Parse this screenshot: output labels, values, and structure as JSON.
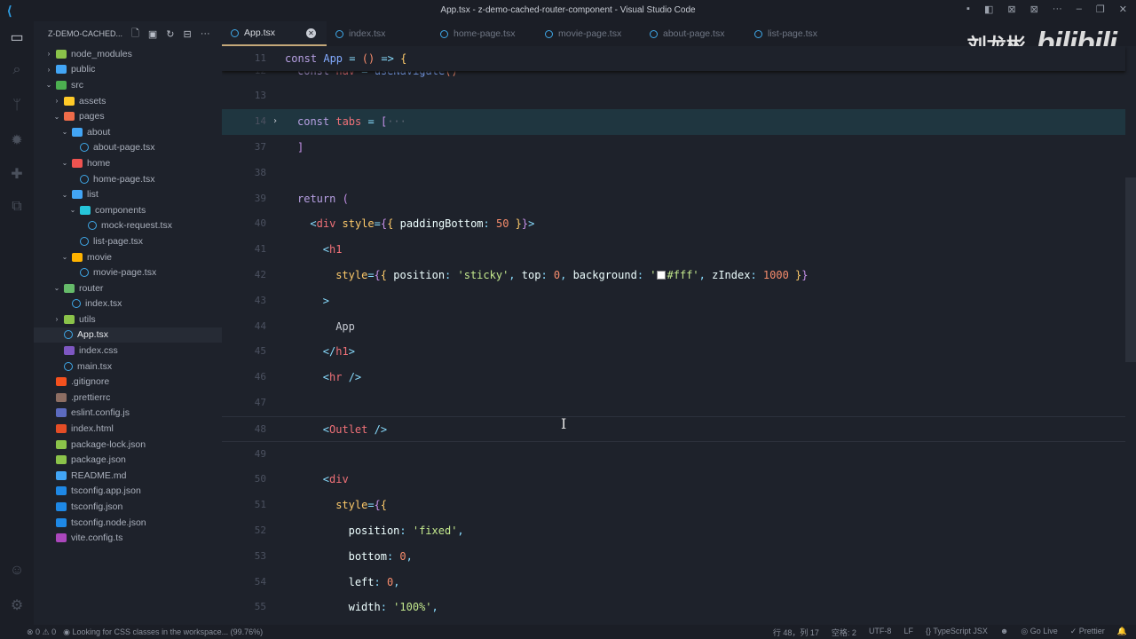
{
  "window": {
    "title": "App.tsx - z-demo-cached-router-component - Visual Studio Code"
  },
  "explorer": {
    "title": "Z-DEMO-CACHED...",
    "items": [
      {
        "label": "node_modules",
        "depth": 0,
        "kind": "folder",
        "open": false,
        "color": "#8bc34a"
      },
      {
        "label": "public",
        "depth": 0,
        "kind": "folder",
        "open": false,
        "color": "#42a5f5"
      },
      {
        "label": "src",
        "depth": 0,
        "kind": "folder",
        "open": true,
        "color": "#4caf50"
      },
      {
        "label": "assets",
        "depth": 1,
        "kind": "folder",
        "open": false,
        "color": "#ffca28"
      },
      {
        "label": "pages",
        "depth": 1,
        "kind": "folder",
        "open": true,
        "color": "#ef6c4a"
      },
      {
        "label": "about",
        "depth": 2,
        "kind": "folder",
        "open": true,
        "color": "#42a5f5"
      },
      {
        "label": "about-page.tsx",
        "depth": 3,
        "kind": "react"
      },
      {
        "label": "home",
        "depth": 2,
        "kind": "folder",
        "open": true,
        "color": "#ef5350"
      },
      {
        "label": "home-page.tsx",
        "depth": 3,
        "kind": "react"
      },
      {
        "label": "list",
        "depth": 2,
        "kind": "folder",
        "open": true,
        "color": "#42a5f5"
      },
      {
        "label": "components",
        "depth": 3,
        "kind": "folder",
        "open": true,
        "color": "#26c6da"
      },
      {
        "label": "mock-request.tsx",
        "depth": 4,
        "kind": "react"
      },
      {
        "label": "list-page.tsx",
        "depth": 3,
        "kind": "react"
      },
      {
        "label": "movie",
        "depth": 2,
        "kind": "folder",
        "open": true,
        "color": "#ffb300"
      },
      {
        "label": "movie-page.tsx",
        "depth": 3,
        "kind": "react"
      },
      {
        "label": "router",
        "depth": 1,
        "kind": "folder",
        "open": true,
        "color": "#66bb6a"
      },
      {
        "label": "index.tsx",
        "depth": 2,
        "kind": "react"
      },
      {
        "label": "utils",
        "depth": 1,
        "kind": "folder",
        "open": false,
        "color": "#8bc34a"
      },
      {
        "label": "App.tsx",
        "depth": 1,
        "kind": "react",
        "selected": true
      },
      {
        "label": "index.css",
        "depth": 1,
        "kind": "file",
        "color": "#7e57c2"
      },
      {
        "label": "main.tsx",
        "depth": 1,
        "kind": "react"
      },
      {
        "label": ".gitignore",
        "depth": 0,
        "kind": "file",
        "color": "#f4511e"
      },
      {
        "label": ".prettierrc",
        "depth": 0,
        "kind": "file",
        "color": "#8d6e63"
      },
      {
        "label": "eslint.config.js",
        "depth": 0,
        "kind": "file",
        "color": "#5c6bc0"
      },
      {
        "label": "index.html",
        "depth": 0,
        "kind": "file",
        "color": "#e44d26"
      },
      {
        "label": "package-lock.json",
        "depth": 0,
        "kind": "file",
        "color": "#8bc34a"
      },
      {
        "label": "package.json",
        "depth": 0,
        "kind": "file",
        "color": "#8bc34a"
      },
      {
        "label": "README.md",
        "depth": 0,
        "kind": "file",
        "color": "#42a5f5"
      },
      {
        "label": "tsconfig.app.json",
        "depth": 0,
        "kind": "file",
        "color": "#1e88e5"
      },
      {
        "label": "tsconfig.json",
        "depth": 0,
        "kind": "file",
        "color": "#1e88e5"
      },
      {
        "label": "tsconfig.node.json",
        "depth": 0,
        "kind": "file",
        "color": "#1e88e5"
      },
      {
        "label": "vite.config.ts",
        "depth": 0,
        "kind": "file",
        "color": "#ab47bc"
      }
    ]
  },
  "tabs": [
    {
      "label": "App.tsx",
      "active": true
    },
    {
      "label": "index.tsx"
    },
    {
      "label": "home-page.tsx"
    },
    {
      "label": "movie-page.tsx"
    },
    {
      "label": "about-page.tsx"
    },
    {
      "label": "list-page.tsx"
    }
  ],
  "watermark": {
    "name": "刘龙彬",
    "logo": "bilibili"
  },
  "editor": {
    "sticky": {
      "n": "11",
      "indent": 0,
      "tokens": [
        [
          "const ",
          "kw"
        ],
        [
          "App",
          "fn"
        ],
        [
          " = ",
          "op"
        ],
        [
          "()",
          "b2"
        ],
        [
          " => ",
          "op"
        ],
        [
          "{",
          "b1"
        ]
      ]
    },
    "lines": [
      {
        "n": "12",
        "indent": 1,
        "tokens": [
          [
            "const ",
            "kw"
          ],
          [
            "nav",
            "var"
          ],
          [
            " = ",
            "op"
          ],
          [
            "useNavigate",
            "fn"
          ],
          [
            "()",
            "b2"
          ]
        ]
      },
      {
        "n": "13",
        "indent": 0,
        "tokens": []
      },
      {
        "n": "14",
        "indent": 1,
        "fold": true,
        "hl": true,
        "tokens": [
          [
            "const ",
            "kw"
          ],
          [
            "tabs",
            "var"
          ],
          [
            " = ",
            "op"
          ],
          [
            "[",
            "b3"
          ],
          [
            "···",
            "dim"
          ]
        ]
      },
      {
        "n": "37",
        "indent": 1,
        "tokens": [
          [
            "]",
            "b3"
          ]
        ]
      },
      {
        "n": "38",
        "indent": 0,
        "tokens": []
      },
      {
        "n": "39",
        "indent": 1,
        "tokens": [
          [
            "return ",
            "kw"
          ],
          [
            "(",
            "b3"
          ]
        ]
      },
      {
        "n": "40",
        "indent": 2,
        "tokens": [
          [
            "<",
            "pn"
          ],
          [
            "div",
            "tag"
          ],
          [
            " style",
            "attr"
          ],
          [
            "=",
            "op"
          ],
          [
            "{",
            "b3"
          ],
          [
            "{",
            "b1"
          ],
          [
            " paddingBottom",
            "prop"
          ],
          [
            ": ",
            "op"
          ],
          [
            "50",
            "num"
          ],
          [
            " }",
            "b1"
          ],
          [
            "}",
            "b3"
          ],
          [
            ">",
            "pn"
          ]
        ]
      },
      {
        "n": "41",
        "indent": 3,
        "tokens": [
          [
            "<",
            "pn"
          ],
          [
            "h1",
            "tag"
          ]
        ]
      },
      {
        "n": "42",
        "indent": 4,
        "tokens": [
          [
            "style",
            "attr"
          ],
          [
            "=",
            "op"
          ],
          [
            "{",
            "b3"
          ],
          [
            "{",
            "b1"
          ],
          [
            " position",
            "prop"
          ],
          [
            ": ",
            "op"
          ],
          [
            "'sticky'",
            "str"
          ],
          [
            ", ",
            "op"
          ],
          [
            "top",
            "prop"
          ],
          [
            ": ",
            "op"
          ],
          [
            "0",
            "num"
          ],
          [
            ", ",
            "op"
          ],
          [
            "background",
            "prop"
          ],
          [
            ": ",
            "op"
          ],
          [
            "'",
            "str"
          ],
          [
            "#fff",
            "str",
            "swatch"
          ],
          [
            "'",
            "str"
          ],
          [
            ", ",
            "op"
          ],
          [
            "zIndex",
            "prop"
          ],
          [
            ": ",
            "op"
          ],
          [
            "1000",
            "num"
          ],
          [
            " }",
            "b1"
          ],
          [
            "}",
            "b3"
          ]
        ]
      },
      {
        "n": "43",
        "indent": 3,
        "tokens": [
          [
            ">",
            "pn"
          ]
        ]
      },
      {
        "n": "44",
        "indent": 4,
        "tokens": [
          [
            "App",
            "txt"
          ]
        ]
      },
      {
        "n": "45",
        "indent": 3,
        "tokens": [
          [
            "</",
            "pn"
          ],
          [
            "h1",
            "tag"
          ],
          [
            ">",
            "pn"
          ]
        ]
      },
      {
        "n": "46",
        "indent": 3,
        "tokens": [
          [
            "<",
            "pn"
          ],
          [
            "hr",
            "tag"
          ],
          [
            " />",
            "pn"
          ]
        ]
      },
      {
        "n": "47",
        "indent": 0,
        "tokens": []
      },
      {
        "n": "48",
        "indent": 3,
        "cur": true,
        "tokens": [
          [
            "<",
            "pn"
          ],
          [
            "Outlet",
            "tag"
          ],
          [
            " />",
            "pn"
          ]
        ]
      },
      {
        "n": "49",
        "indent": 0,
        "tokens": []
      },
      {
        "n": "50",
        "indent": 3,
        "tokens": [
          [
            "<",
            "pn"
          ],
          [
            "div",
            "tag"
          ]
        ]
      },
      {
        "n": "51",
        "indent": 4,
        "tokens": [
          [
            "style",
            "attr"
          ],
          [
            "=",
            "op"
          ],
          [
            "{",
            "b3"
          ],
          [
            "{",
            "b1"
          ]
        ]
      },
      {
        "n": "52",
        "indent": 5,
        "tokens": [
          [
            "position",
            "prop"
          ],
          [
            ": ",
            "op"
          ],
          [
            "'fixed'",
            "str"
          ],
          [
            ",",
            "op"
          ]
        ]
      },
      {
        "n": "53",
        "indent": 5,
        "tokens": [
          [
            "bottom",
            "prop"
          ],
          [
            ": ",
            "op"
          ],
          [
            "0",
            "num"
          ],
          [
            ",",
            "op"
          ]
        ]
      },
      {
        "n": "54",
        "indent": 5,
        "tokens": [
          [
            "left",
            "prop"
          ],
          [
            ": ",
            "op"
          ],
          [
            "0",
            "num"
          ],
          [
            ",",
            "op"
          ]
        ]
      },
      {
        "n": "55",
        "indent": 5,
        "tokens": [
          [
            "width",
            "prop"
          ],
          [
            ": ",
            "op"
          ],
          [
            "'100%'",
            "str"
          ],
          [
            ",",
            "op"
          ]
        ]
      }
    ]
  },
  "status": {
    "errors": "0",
    "warnings": "0",
    "message": "Looking for CSS classes in the workspace... (99.76%)",
    "position": "行 48，列 17",
    "spaces": "空格: 2",
    "encoding": "UTF-8",
    "eol": "LF",
    "language": "TypeScript JSX",
    "golive": "Go Live",
    "prettier": "Prettier"
  }
}
